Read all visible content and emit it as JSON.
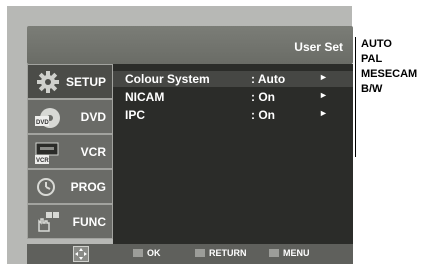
{
  "header": {
    "title": "User Set"
  },
  "sidebar": {
    "items": [
      {
        "label": "SETUP",
        "icon": "gear-icon"
      },
      {
        "label": "DVD",
        "icon": "dvd-icon"
      },
      {
        "label": "VCR",
        "icon": "vcr-icon"
      },
      {
        "label": "PROG",
        "icon": "clock-icon"
      },
      {
        "label": "FUNC",
        "icon": "hand-icon"
      }
    ],
    "active": "SETUP"
  },
  "settings": [
    {
      "name": "Colour System",
      "value": ": Auto",
      "arrow": "►"
    },
    {
      "name": "NICAM",
      "value": ": On",
      "arrow": "►"
    },
    {
      "name": "IPC",
      "value": ": On",
      "arrow": "►"
    }
  ],
  "footer": {
    "nav_icon": "nav-pad-icon",
    "ok_label": "OK",
    "return_label": "RETURN",
    "menu_label": "MENU"
  },
  "options": [
    "AUTO",
    "PAL",
    "MESECAM",
    "B/W"
  ],
  "colors": {
    "screen_bg": "#b7b8b5",
    "content_bg": "#2b2c29",
    "menu_bg": "#6a6b67",
    "text": "#ffffff"
  }
}
